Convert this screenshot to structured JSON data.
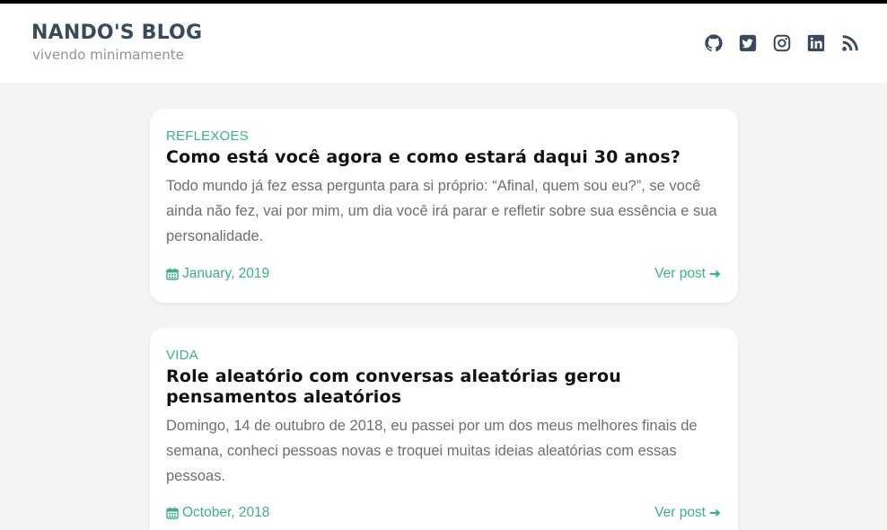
{
  "header": {
    "title": "NANDO'S BLOG",
    "subtitle": "vivendo minimamente",
    "social_icons": [
      "github-icon",
      "twitter-icon",
      "instagram-icon",
      "linkedin-icon",
      "rss-icon"
    ]
  },
  "posts": [
    {
      "category": "REFLEXOES",
      "title": "Como está você agora e como estará daqui 30 anos?",
      "excerpt": "Todo mundo já fez essa pergunta para si próprio: “Afinal, quem sou eu?”, se você ainda não fez, vai por mim, um dia você irá parar e refletir sobre sua essência e sua personalidade.",
      "date": "January, 2019",
      "link_label": "Ver post"
    },
    {
      "category": "VIDA",
      "title": "Role aleatório com conversas aleatórias gerou pensamentos aleatórios",
      "excerpt": "Domingo, 14 de outubro de 2018, eu passei por um dos meus melhores finais de semana, conheci pessoas novas e troquei muitas ideias aleatórias com essas pessoas.",
      "date": "October, 2018",
      "link_label": "Ver post"
    }
  ],
  "colors": {
    "accent": "#3db28a",
    "header_text": "#3a4a5c",
    "background": "#f4f4f4"
  }
}
